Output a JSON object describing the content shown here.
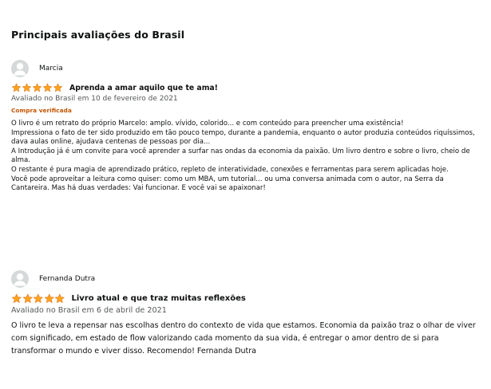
{
  "section_title": "Principais avaliações do Brasil",
  "colors": {
    "star": "#ffa41c",
    "verified": "#c45500",
    "date": "#565959",
    "avatar_bg": "#d5d9d9",
    "avatar_fg": "#ffffff"
  },
  "reviews": [
    {
      "author": "Marcia",
      "avatar_icon": "default-user-icon",
      "rating": 5,
      "title": "Aprenda a amar aquilo que te ama!",
      "date": "Avaliado no Brasil em 10 de fevereiro de 2021",
      "verified": "Compra verificada",
      "body": [
        "O livro é um retrato do próprio Marcelo: amplo. vívido, colorido... e com conteúdo para preencher uma existência!",
        "Impressiona o fato de ter sido produzido em tão pouco tempo, durante a pandemia, enquanto o autor produzia conteúdos riquíssimos, dava aulas online, ajudava centenas de pessoas por dia...",
        "A Introdução já é um convite para você aprender a surfar nas ondas da economia da paixão. Um livro dentro e sobre o livro, cheio de alma.",
        "O restante é pura magia de aprendizado prático, repleto de interatividade, conexões e ferramentas para serem aplicadas hoje.",
        "Você pode aproveitar a leitura como quiser: como um MBA, um tutorial... ou uma conversa animada com o autor, na Serra da Cantareira. Mas há duas verdades: Vai funcionar. E você vai se apaixonar!"
      ]
    },
    {
      "author": "Fernanda Dutra",
      "avatar_icon": "default-user-icon",
      "rating": 5,
      "title": "Livro atual e que traz muitas reflexões",
      "date": "Avaliado no Brasil em 6 de abril de 2021",
      "body": [
        "O livro te leva a repensar nas escolhas dentro do contexto de vida que estamos. Economia da paixão traz o olhar de viver com significado, em estado de flow valorizando cada momento da sua vida, é entregar o amor dentro de si para transformar o mundo e viver disso. Recomendo! Fernanda Dutra"
      ]
    }
  ]
}
